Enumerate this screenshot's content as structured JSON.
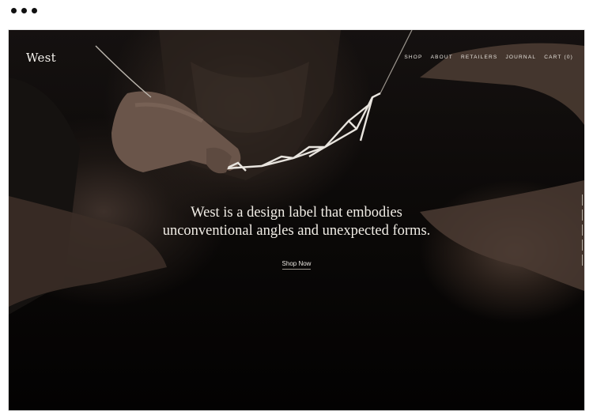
{
  "site": {
    "logo": "West"
  },
  "nav": {
    "items": [
      {
        "label": "SHOP"
      },
      {
        "label": "ABOUT"
      },
      {
        "label": "RETAILERS"
      },
      {
        "label": "JOURNAL"
      },
      {
        "label": "CART (0)"
      }
    ]
  },
  "hero": {
    "headline_line1": "West is a design label that embodies",
    "headline_line2": "unconventional angles and unexpected forms.",
    "cta_label": "Shop Now",
    "image_icon": "necklace-model-photo"
  },
  "colors": {
    "background": "#000000",
    "text": "#f1ede6"
  }
}
